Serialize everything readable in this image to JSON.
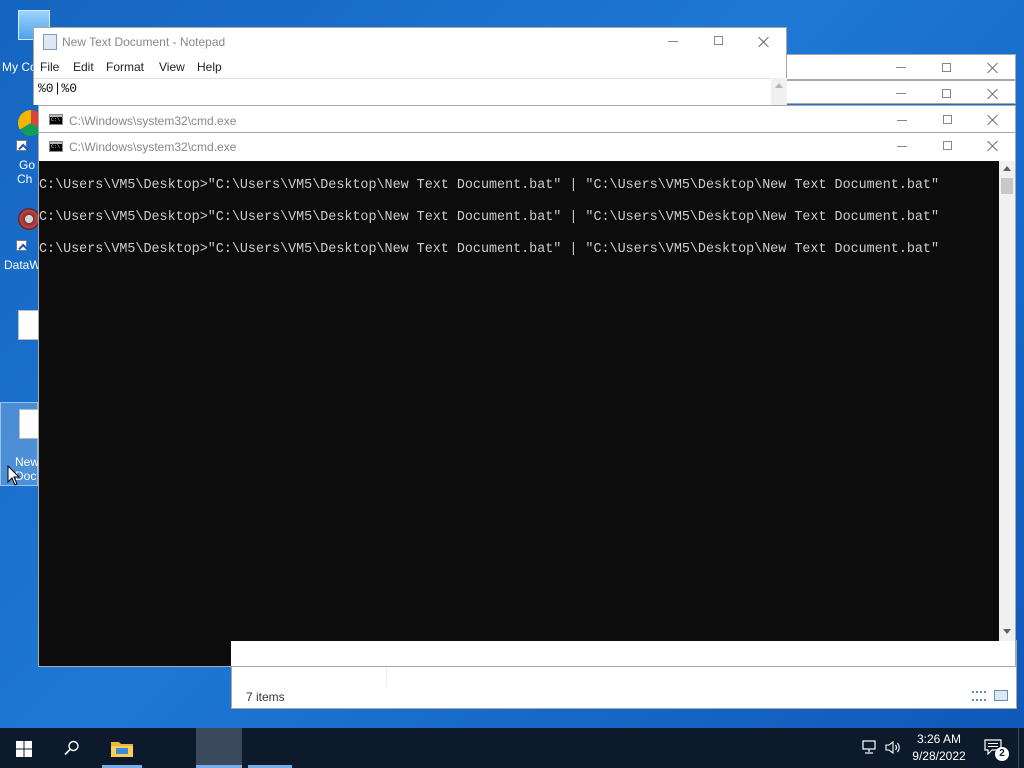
{
  "desktop": {
    "icons": [
      {
        "label": "My Co",
        "kind": "computer"
      },
      {
        "label": "Go",
        "label2": "Ch",
        "kind": "chrome"
      },
      {
        "label": "DataW",
        "kind": "app"
      },
      {
        "label": "",
        "kind": "file"
      },
      {
        "label": "New",
        "label2": "Doc",
        "kind": "file-selected"
      }
    ]
  },
  "notepad": {
    "title": "New Text Document - Notepad",
    "menu": [
      "File",
      "Edit",
      "Format",
      "View",
      "Help"
    ],
    "content": "%0|%0"
  },
  "cmd_back": {
    "title": "C:\\Windows\\system32\\cmd.exe"
  },
  "cmd_front": {
    "title": "C:\\Windows\\system32\\cmd.exe",
    "lines": [
      "C:\\Users\\VM5\\Desktop>\"C:\\Users\\VM5\\Desktop\\New Text Document.bat\" | \"C:\\Users\\VM5\\Desktop\\New Text Document.bat\"",
      "C:\\Users\\VM5\\Desktop>\"C:\\Users\\VM5\\Desktop\\New Text Document.bat\" | \"C:\\Users\\VM5\\Desktop\\New Text Document.bat\"",
      "C:\\Users\\VM5\\Desktop>\"C:\\Users\\VM5\\Desktop\\New Text Document.bat\" | \"C:\\Users\\VM5\\Desktop\\New Text Document.bat\""
    ]
  },
  "explorer": {
    "status": "7 items"
  },
  "taskbar": {
    "time": "3:26 AM",
    "date": "9/28/2022",
    "notifications": "2",
    "icons": [
      "windows-start-icon",
      "search-icon",
      "file-explorer-icon",
      "network-icon",
      "volume-icon",
      "action-center-icon"
    ]
  },
  "colors": {
    "desktop": "#1565c0",
    "console_bg": "#0c0c0c",
    "console_text": "#cccccc",
    "taskbar": "#0d1a2b"
  }
}
